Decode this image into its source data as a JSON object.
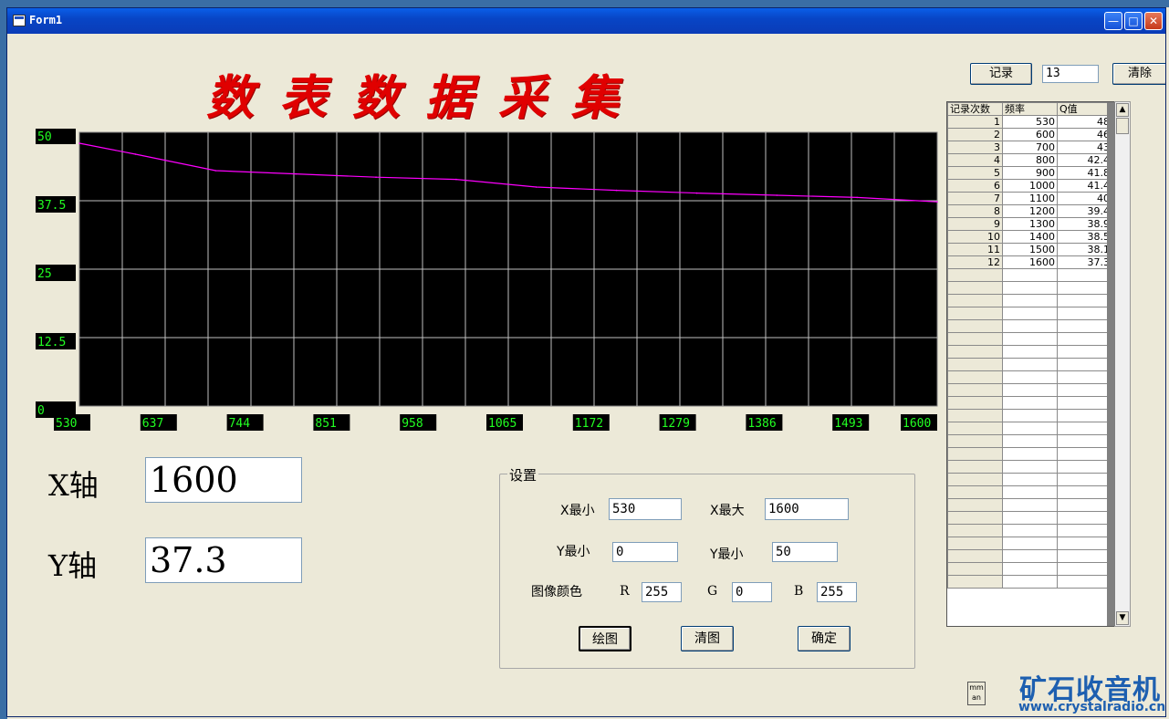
{
  "window": {
    "title": "Form1"
  },
  "title": "数表数据采集",
  "record_button": "记录",
  "record_count": "13",
  "clear_button": "清除",
  "table": {
    "headers": [
      "记录次数",
      "频率",
      "Q值"
    ],
    "rows": [
      [
        "1",
        "530",
        "48"
      ],
      [
        "2",
        "600",
        "46"
      ],
      [
        "3",
        "700",
        "43"
      ],
      [
        "4",
        "800",
        "42.4"
      ],
      [
        "5",
        "900",
        "41.8"
      ],
      [
        "6",
        "1000",
        "41.4"
      ],
      [
        "7",
        "1100",
        "40"
      ],
      [
        "8",
        "1200",
        "39.4"
      ],
      [
        "9",
        "1300",
        "38.9"
      ],
      [
        "10",
        "1400",
        "38.5"
      ],
      [
        "11",
        "1500",
        "38.1"
      ],
      [
        "12",
        "1600",
        "37.3"
      ]
    ],
    "empty_rows": 25
  },
  "chart_data": {
    "type": "line",
    "x": [
      530,
      600,
      700,
      800,
      900,
      1000,
      1100,
      1200,
      1300,
      1400,
      1500,
      1600
    ],
    "y": [
      48,
      46,
      43,
      42.4,
      41.8,
      41.4,
      40,
      39.4,
      38.9,
      38.5,
      38.1,
      37.3
    ],
    "xlim": [
      530,
      1600
    ],
    "ylim": [
      0,
      50
    ],
    "x_tick_labels": [
      "530",
      "637",
      "744",
      "851",
      "958",
      "1065",
      "1172",
      "1279",
      "1386",
      "1493",
      "1600"
    ],
    "y_tick_labels": [
      "50",
      "37.5",
      "25",
      "12.5",
      "0"
    ],
    "line_color": "#ff00ff",
    "background": "#000000",
    "grid": true,
    "grid_color": "#c0c0c0"
  },
  "readout": {
    "x_label": "X轴",
    "x_value": "1600",
    "y_label": "Y轴",
    "y_value": "37.3"
  },
  "settings": {
    "legend": "设置",
    "x_min_label": "X最小",
    "x_min": "530",
    "x_max_label": "X最大",
    "x_max": "1600",
    "y_min_label": "Y最小",
    "y_min": "0",
    "y_max_label": "Y最小",
    "y_max": "50",
    "color_label": "图像颜色",
    "r_label": "R",
    "r": "255",
    "g_label": "G",
    "g": "0",
    "b_label": "B",
    "b": "255",
    "draw_button": "绘图",
    "clear_plot_button": "清图",
    "ok_button": "确定"
  },
  "corner_button": "mm an",
  "logo": {
    "name": "矿石收音机",
    "url": "www.crystalradio.cn"
  }
}
